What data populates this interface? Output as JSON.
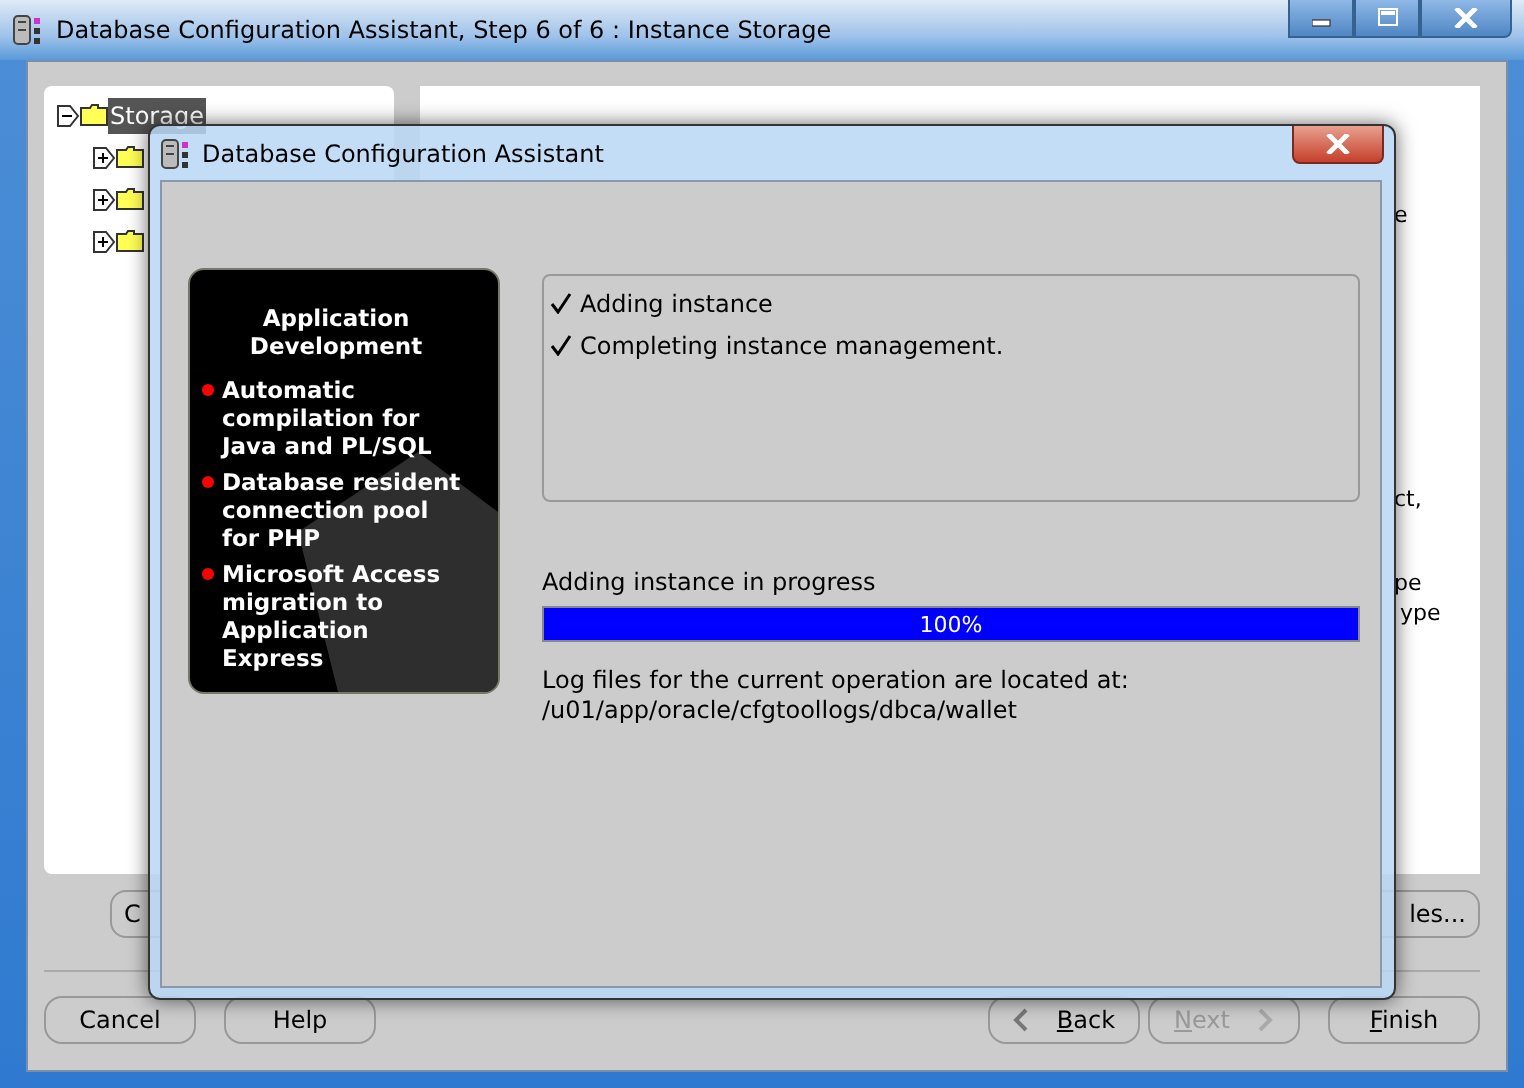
{
  "window": {
    "title": "Database Configuration Assistant, Step 6 of 6 : Instance Storage"
  },
  "tree": [
    {
      "label": "Storage",
      "selected": true,
      "expanded": true,
      "children": [
        {
          "expanded": false
        },
        {
          "expanded": false
        },
        {
          "expanded": false
        }
      ]
    }
  ],
  "right_panel": {
    "fragments": [
      "e",
      "ct,",
      "pe",
      "ype"
    ]
  },
  "panel_buttons": [
    "C",
    "les..."
  ],
  "buttons": [
    {
      "label": "Cancel",
      "disabled": false,
      "underline_first": false
    },
    {
      "label": "Help",
      "disabled": false,
      "underline_first": false
    },
    {
      "label": "Back",
      "disabled": false,
      "underline_first": true,
      "kind": "back"
    },
    {
      "label": "Next",
      "disabled": true,
      "underline_first": true,
      "kind": "next"
    },
    {
      "label": "Finish",
      "disabled": false,
      "underline_first": true
    }
  ],
  "dialog": {
    "title": "Database Configuration Assistant",
    "promo": {
      "heading": "Application Development",
      "bullets": [
        "Automatic compilation for Java and PL/SQL",
        "Database resident connection pool for PHP",
        "Microsoft Access migration to Application Express"
      ]
    },
    "steps": [
      {
        "label": "Adding instance",
        "done": true
      },
      {
        "label": "Completing instance management.",
        "done": true
      }
    ],
    "progress": {
      "label": "Adding instance in progress",
      "level": 1,
      "reading": "100%"
    },
    "log": [
      "Log files for the current operation are located at:",
      "/u01/app/oracle/cfgtoollogs/dbca/wallet"
    ]
  }
}
